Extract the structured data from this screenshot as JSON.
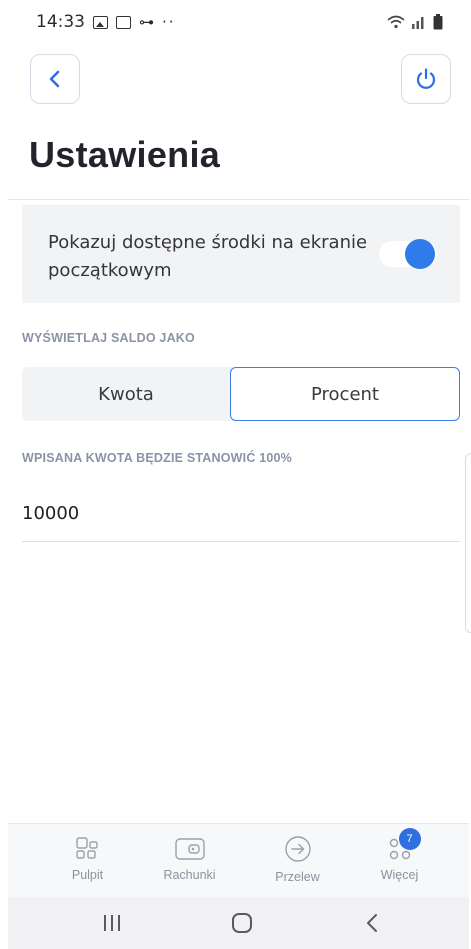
{
  "status_bar": {
    "time": "14:33",
    "icons": [
      "gallery-icon",
      "calendar-icon",
      "key-icon",
      "more-dots-icon",
      "wifi-icon",
      "signal-icon",
      "battery-icon"
    ]
  },
  "header": {
    "back_icon": "chevron-left-icon",
    "power_icon": "power-icon",
    "title": "Ustawienia"
  },
  "settings": {
    "show_funds_label": "Pokazuj dostępne środki na ekranie początkowym",
    "show_funds_enabled": true,
    "balance_section_label": "WYŚWIETLAJ SALDO JAKO",
    "balance_options": [
      "Kwota",
      "Procent"
    ],
    "balance_selected": "Procent",
    "amount_section_label": "WPISANA KWOTA BĘDZIE STANOWIĆ 100%",
    "amount_value": "10000"
  },
  "tab_bar": {
    "items": [
      {
        "label": "Pulpit",
        "icon": "dashboard-icon"
      },
      {
        "label": "Rachunki",
        "icon": "wallet-icon"
      },
      {
        "label": "Przelew",
        "icon": "transfer-icon"
      },
      {
        "label": "Więcej",
        "icon": "more-icon",
        "badge": "7"
      }
    ]
  },
  "system_nav": {
    "icons": [
      "recent-apps-icon",
      "home-icon",
      "back-icon"
    ]
  },
  "colors": {
    "accent": "#2f7bea",
    "card_background": "#f2f3f5",
    "section_label": "#8a93a6",
    "badge": "#2f6fe0"
  }
}
